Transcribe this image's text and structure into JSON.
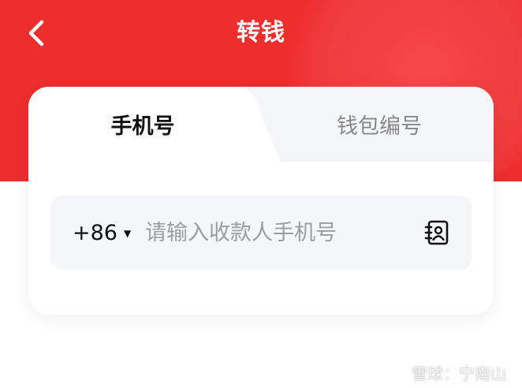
{
  "header": {
    "title": "转钱",
    "back_icon": "chevron-left-icon",
    "background_color": "#ee2d2d"
  },
  "tabs": [
    {
      "label": "手机号",
      "active": true
    },
    {
      "label": "钱包编号",
      "active": false
    }
  ],
  "phone_field": {
    "country_code": "+86",
    "country_caret": "▼",
    "placeholder": "请输入收款人手机号",
    "value": "",
    "contacts_icon": "contacts-book-icon"
  },
  "watermark": {
    "brand": "雪球",
    "separator": "：",
    "author": "宁南山"
  }
}
